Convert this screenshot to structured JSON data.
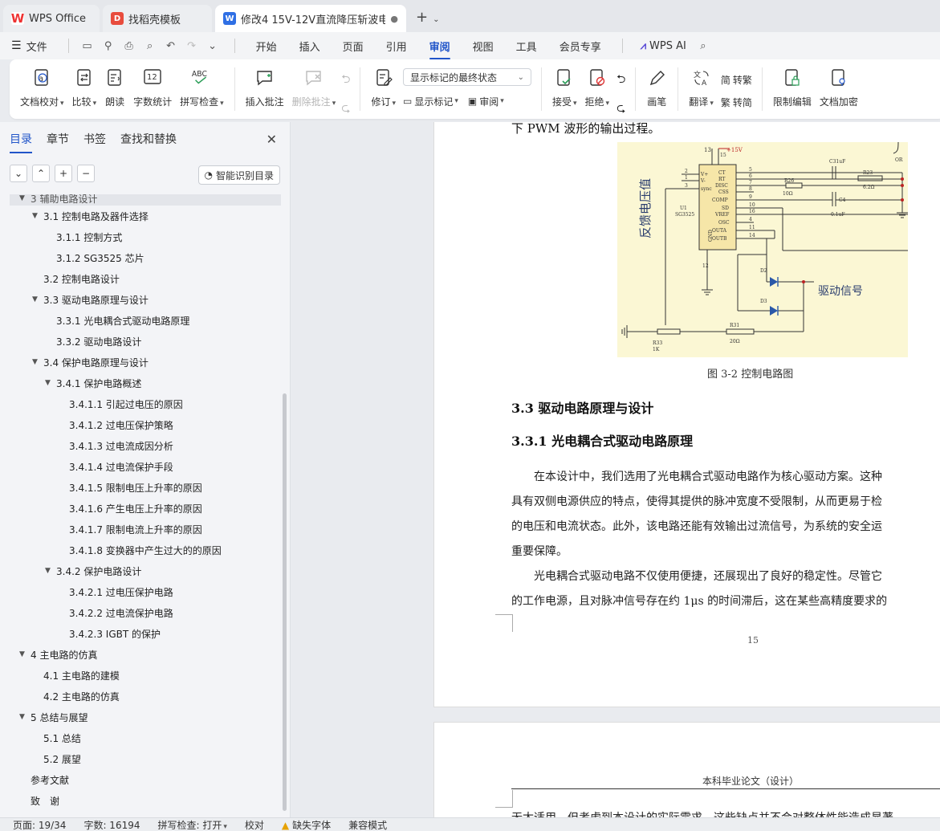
{
  "tabs": [
    {
      "label": "WPS Office"
    },
    {
      "label": "找稻壳模板"
    },
    {
      "label": "修改4 15V-12V直流降压斩波电"
    }
  ],
  "menu": {
    "file": "文件",
    "tabs": [
      "开始",
      "插入",
      "页面",
      "引用",
      "审阅",
      "视图",
      "工具",
      "会员专享"
    ],
    "active": "审阅",
    "ai": "WPS AI"
  },
  "ribbon": {
    "doc_check": "文档校对",
    "compare": "比较",
    "read_aloud": "朗读",
    "word_count": "字数统计",
    "spell_check": "拼写检查",
    "insert_comment": "插入批注",
    "delete_comment": "删除批注",
    "revise": "修订",
    "markup_select": "显示标记的最终状态",
    "show_markup": "显示标记",
    "review": "审阅",
    "accept": "接受",
    "reject": "拒绝",
    "pen": "画笔",
    "translate": "翻译",
    "to_traditional": "转繁",
    "to_simplified": "转简",
    "restrict_edit": "限制编辑",
    "encrypt": "文档加密",
    "icon_wordcount": "12",
    "icon_spell": "ABC"
  },
  "leftpane": {
    "tabs": [
      "目录",
      "章节",
      "书签",
      "查找和替换"
    ],
    "smart_btn": "智能识别目录",
    "toc": [
      {
        "text": "3  辅助电路设计",
        "level": 0,
        "tri": "▼",
        "first": true
      },
      {
        "text": "3.1 控制电路及器件选择",
        "level": 1,
        "tri": "▼"
      },
      {
        "text": "3.1.1  控制方式",
        "level": 2,
        "tri": ""
      },
      {
        "text": "3.1.2 SG3525 芯片",
        "level": 2,
        "tri": ""
      },
      {
        "text": "3.2 控制电路设计",
        "level": 1,
        "tri": ""
      },
      {
        "text": "3.3  驱动电路原理与设计",
        "level": 1,
        "tri": "▼"
      },
      {
        "text": "3.3.1  光电耦合式驱动电路原理",
        "level": 2,
        "tri": ""
      },
      {
        "text": "3.3.2  驱动电路设计",
        "level": 2,
        "tri": ""
      },
      {
        "text": "3.4 保护电路原理与设计",
        "level": 1,
        "tri": "▼"
      },
      {
        "text": "3.4.1 保护电路概述",
        "level": 2,
        "tri": "▼"
      },
      {
        "text": "3.4.1.1  引起过电压的原因",
        "level": 3,
        "tri": ""
      },
      {
        "text": "3.4.1.2  过电压保护策略",
        "level": 3,
        "tri": ""
      },
      {
        "text": "3.4.1.3  过电流成因分析",
        "level": 3,
        "tri": ""
      },
      {
        "text": "3.4.1.4  过电流保护手段",
        "level": 3,
        "tri": ""
      },
      {
        "text": "3.4.1.5  限制电压上升率的原因",
        "level": 3,
        "tri": ""
      },
      {
        "text": "3.4.1.6  产生电压上升率的原因",
        "level": 3,
        "tri": ""
      },
      {
        "text": "3.4.1.7  限制电流上升率的原因",
        "level": 3,
        "tri": ""
      },
      {
        "text": "3.4.1.8  变换器中产生过大的的原因",
        "level": 3,
        "tri": ""
      },
      {
        "text": "3.4.2  保护电路设计",
        "level": 2,
        "tri": "▼"
      },
      {
        "text": "3.4.2.1  过电压保护电路",
        "level": 3,
        "tri": ""
      },
      {
        "text": "3.4.2.2  过电流保护电路",
        "level": 3,
        "tri": ""
      },
      {
        "text": "3.4.2.3 IGBT 的保护",
        "level": 3,
        "tri": ""
      },
      {
        "text": "4 主电路的仿真",
        "level": 0,
        "tri": "▼"
      },
      {
        "text": "4.1  主电路的建模",
        "level": 1,
        "tri": ""
      },
      {
        "text": "4.2  主电路的仿真",
        "level": 1,
        "tri": ""
      },
      {
        "text": "5  总结与展望",
        "level": 0,
        "tri": "▼"
      },
      {
        "text": "5.1  总结",
        "level": 1,
        "tri": ""
      },
      {
        "text": "5.2  展望",
        "level": 1,
        "tri": ""
      },
      {
        "text": "参考文献",
        "level": 0,
        "tri": ""
      },
      {
        "text": "致　谢",
        "level": 0,
        "tri": ""
      }
    ]
  },
  "doc": {
    "top_line": "下 PWM 波形的输出过程。",
    "figure": {
      "label_feedback": "反馈电压值",
      "label_drive": "驱动信号",
      "u1": "U1",
      "chip": "SG3525",
      "vplus": "+15V",
      "pins_left": [
        "V+",
        "V-",
        "sync"
      ],
      "pins_right": [
        "CT",
        "RT",
        "DISC",
        "CSS",
        "COMP",
        "SD",
        "VREF",
        "OSC",
        "OUTA",
        "OUTB"
      ],
      "gnd": "GND",
      "nums_left": [
        "2",
        "1",
        "3"
      ],
      "nums_right": [
        "5",
        "6",
        "7",
        "8",
        "9",
        "10",
        "16",
        "4",
        "11",
        "14"
      ],
      "num_top": "13",
      "num_top2": "15",
      "num_bottom": "12",
      "c31": "C31uF",
      "r23": "R23",
      "r23v": "6.2Ω",
      "r26": "R26",
      "r26v": "10Ω",
      "c4": "C4",
      "c4v": "0.1uF",
      "d2": "D2",
      "d3": "D3",
      "r31": "R31",
      "r31v": "20Ω",
      "r33": "R33",
      "r33v": "1K",
      "or": "OR"
    },
    "caption": "图 3-2  控制电路图",
    "h2": "3.3  驱动电路原理与设计",
    "h3": "3.3.1  光电耦合式驱动电路原理",
    "para1": [
      "　　在本设计中，我们选用了光电耦合式驱动电路作为核心驱动方案。这种",
      "具有双侧电源供应的特点，使得其提供的脉冲宽度不受限制，从而更易于检",
      "的电压和电流状态。此外，该电路还能有效输出过流信号，为系统的安全运",
      "重要保障。"
    ],
    "para2": [
      "　　光电耦合式驱动电路不仅使用便捷，还展现出了良好的稳定性。尽管它",
      "的工作电源，且对脉冲信号存在约 1μs 的时间滞后，这在某些高精度要求的"
    ],
    "page_no": "15",
    "page2_header": "本科毕业论文（设计）",
    "page2_partial": "无太适用，但考虑到本设计的实际需求，这些缺点并不会对整体性能造成显著"
  },
  "status": {
    "page": "页面: 19/34",
    "words": "字数: 16194",
    "spell": "拼写检查: 打开",
    "proof": "校对",
    "missing_font": "缺失字体",
    "compat": "兼容模式"
  },
  "colors": {
    "accent": "#2155c9",
    "figure_bg": "#fbf7d4",
    "wps_red": "#e33333"
  }
}
